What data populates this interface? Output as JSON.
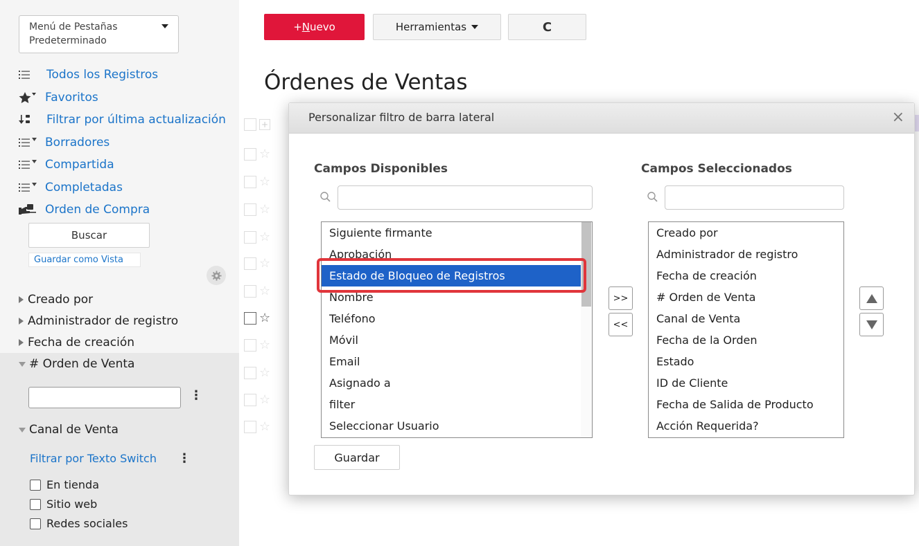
{
  "sidebar": {
    "tab_menu_label": "Menú de Pestañas Predeterminado",
    "nav_items": [
      {
        "label": "Todos los Registros",
        "icon": "list-icon"
      },
      {
        "label": "Favoritos",
        "icon": "star-filter-icon"
      },
      {
        "label": "Filtrar por última actualización",
        "icon": "sort-down-icon"
      },
      {
        "label": "Borradores",
        "icon": "list-filter-icon"
      },
      {
        "label": "Compartida",
        "icon": "list-filter-icon"
      },
      {
        "label": "Completadas",
        "icon": "list-filter-icon"
      },
      {
        "label": "Orden de Compra",
        "icon": "purchase-order-icon"
      }
    ],
    "search_button": "Buscar",
    "save_view": "Guardar como Vista",
    "filter_fields": [
      {
        "label": "Creado por",
        "expanded": false
      },
      {
        "label": "Administrador de registro",
        "expanded": false
      },
      {
        "label": "Fecha de creación",
        "expanded": false
      },
      {
        "label": "# Orden de Venta",
        "expanded": true
      },
      {
        "label": "Canal de Venta",
        "expanded": true
      }
    ],
    "order_input_value": "",
    "filter_switch_label": "Filtrar por Texto Switch",
    "channel_options": [
      {
        "label": "En tienda",
        "checked": false
      },
      {
        "label": "Sitio web",
        "checked": false
      },
      {
        "label": "Redes sociales",
        "checked": false
      }
    ]
  },
  "toolbar": {
    "new_prefix": "+",
    "new_underlined": "N",
    "new_rest": "uevo",
    "tools_label": "Herramientas",
    "refresh_glyph": "C"
  },
  "main": {
    "page_title": "Órdenes de Ventas"
  },
  "modal": {
    "title": "Personalizar filtro de barra lateral",
    "close_glyph": "×",
    "available_title": "Campos Disponibles",
    "selected_title": "Campos Seleccionados",
    "available_search_value": "",
    "selected_search_value": "",
    "available_fields": [
      "Siguiente firmante",
      "Aprobación",
      "Estado de Bloqueo de Registros",
      "Nombre",
      "Teléfono",
      "Móvil",
      "Email",
      "Asignado a",
      "filter",
      "Seleccionar Usuario"
    ],
    "available_selected_index": 2,
    "selected_fields": [
      "Creado por",
      "Administrador de registro",
      "Fecha de creación",
      "# Orden de Venta",
      "Canal de Venta",
      "Fecha de la Orden",
      "Estado",
      "ID de Cliente",
      "Fecha de Salida de Producto",
      "Acción Requerida?"
    ],
    "add_button": ">>",
    "remove_button": "<<",
    "save_button": "Guardar"
  },
  "colors": {
    "accent_red": "#e0163a",
    "link_blue": "#1b74c9",
    "selection_blue": "#1e62c8",
    "highlight_red": "#e0353b"
  }
}
